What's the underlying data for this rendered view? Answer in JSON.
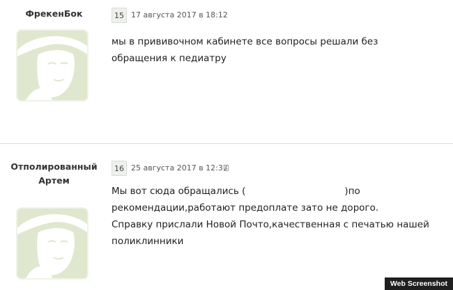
{
  "posts": [
    {
      "username": "ФрекенБок",
      "number": "15",
      "date": "17 августа 2017 в 18:12",
      "message_lines": [
        "мы в прививочном кабинете все вопросы решали без обращения к педиатру"
      ]
    },
    {
      "username": "Отполированный Артем",
      "number": "16",
      "date": "25 августа 2017 в 12:37",
      "device_icon": "mobile-device-icon",
      "message_line_1_before": "Мы вот сюда обращались (",
      "message_line_1_after": ")по",
      "message_lines": [
        "рекомендации,работают предоплате зато не дорого.",
        "Справку прислали Новой Почто,качественная с печатью нашей поликлинники"
      ]
    }
  ],
  "avatar_icon": "default-avatar-woman-hat-icon",
  "colors": {
    "avatar_bg": "#dfe7cf",
    "avatar_figure": "#ffffff",
    "post_number_bg": "#eef0ec",
    "separator": "#dcdcdc"
  },
  "watermark": "Web Screenshot"
}
